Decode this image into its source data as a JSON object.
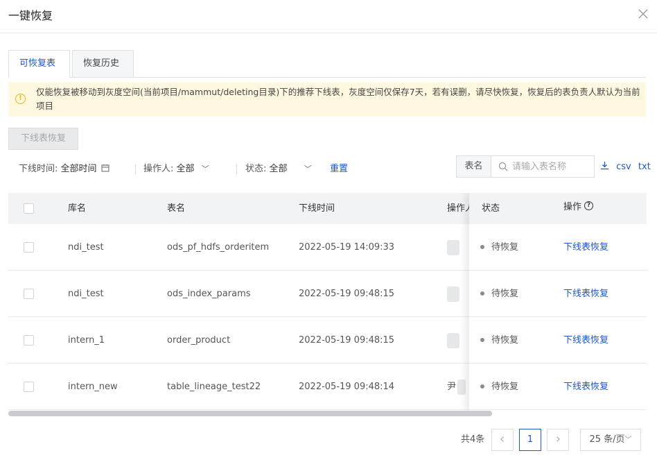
{
  "modal": {
    "title": "一键恢复"
  },
  "tabs": [
    {
      "label": "可恢复表",
      "active": true
    },
    {
      "label": "恢复历史",
      "active": false
    }
  ],
  "alert": {
    "text": "仅能恢复被移动到灰度空间(当前项目/mammut/deleting目录)下的推荐下线表，灰度空间仅保存7天，若有误删，请尽快恢复，恢复后的表负责人默认为当前项目",
    "icon": "warning-icon",
    "color": "#f0b400"
  },
  "toolbar": {
    "restore_label": "下线表恢复"
  },
  "filters": {
    "time_label": "下线时间:",
    "time_value": "全部时间",
    "operator_label": "操作人:",
    "operator_value": "全部",
    "status_label": "状态:",
    "status_value": "全部",
    "reset_label": "重置"
  },
  "search": {
    "label": "表名",
    "placeholder": "请输入表名称"
  },
  "export": {
    "csv": "csv",
    "txt": "txt"
  },
  "table": {
    "columns": [
      "库名",
      "表名",
      "下线时间",
      "操作人",
      "状态",
      "操作"
    ],
    "rows": [
      {
        "db": "ndi_test",
        "table": "ods_pf_hdfs_orderitem",
        "time": "2022-05-19 14:09:33",
        "operator": "",
        "status": "待恢复",
        "action": "下线表恢复"
      },
      {
        "db": "ndi_test",
        "table": "ods_index_params",
        "time": "2022-05-19 09:48:15",
        "operator": "",
        "status": "待恢复",
        "action": "下线表恢复"
      },
      {
        "db": "intern_1",
        "table": "order_product",
        "time": "2022-05-19 09:48:15",
        "operator": "",
        "status": "待恢复",
        "action": "下线表恢复"
      },
      {
        "db": "intern_new",
        "table": "table_lineage_test22",
        "time": "2022-05-19 09:48:14",
        "operator": "尹",
        "status": "待恢复",
        "action": "下线表恢复"
      }
    ]
  },
  "pagination": {
    "total": "共4条",
    "current": "1",
    "page_size": "25 条/页"
  },
  "colors": {
    "accent": "#1e56c6",
    "status_dot": "#868b94",
    "alert_bg": "#fff8e1"
  }
}
